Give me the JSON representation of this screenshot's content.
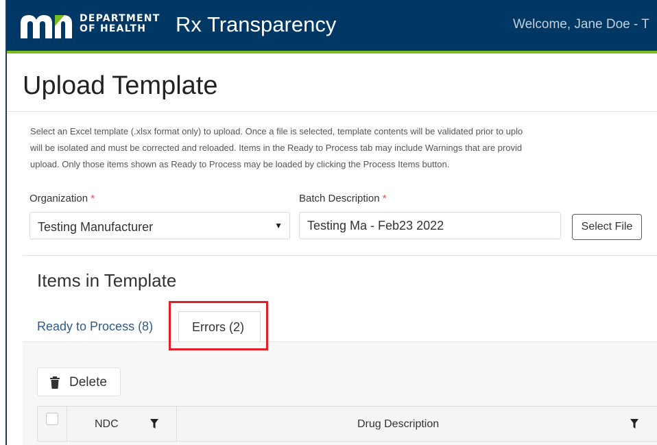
{
  "header": {
    "logo_line1": "DEPARTMENT",
    "logo_line2": "OF HEALTH",
    "app_title": "Rx Transparency",
    "welcome": "Welcome, Jane Doe - T"
  },
  "page": {
    "title": "Upload Template",
    "instructions": [
      "Select an Excel template (.xlsx format only) to upload. Once a file is selected, template contents will be validated prior to uplo",
      "will be isolated and must be corrected and reloaded. Items in the Ready to Process tab may include Warnings that are provid",
      "upload. Only those items shown as Ready to Process may be loaded by clicking the Process Items button."
    ]
  },
  "form": {
    "organization_label": "Organization",
    "organization_value": "Testing Manufacturer",
    "batch_label": "Batch Description",
    "batch_value": "Testing Ma - Feb23 2022",
    "required_mark": "*",
    "select_file_label": "Select File"
  },
  "items": {
    "section_title": "Items in Template",
    "tabs": [
      {
        "label": "Ready to Process (8)"
      },
      {
        "label": "Errors (2)"
      }
    ],
    "delete_label": "Delete",
    "columns": [
      {
        "label": "NDC"
      },
      {
        "label": "Drug Description"
      }
    ]
  },
  "colors": {
    "header_bg": "#003865",
    "header_accent": "#78be20",
    "link": "#2e5b8a",
    "highlight": "#e41e26",
    "required": "#d9534f"
  },
  "icons": [
    "mn-logo",
    "dropdown-caret-icon",
    "trash-icon",
    "filter-icon"
  ]
}
